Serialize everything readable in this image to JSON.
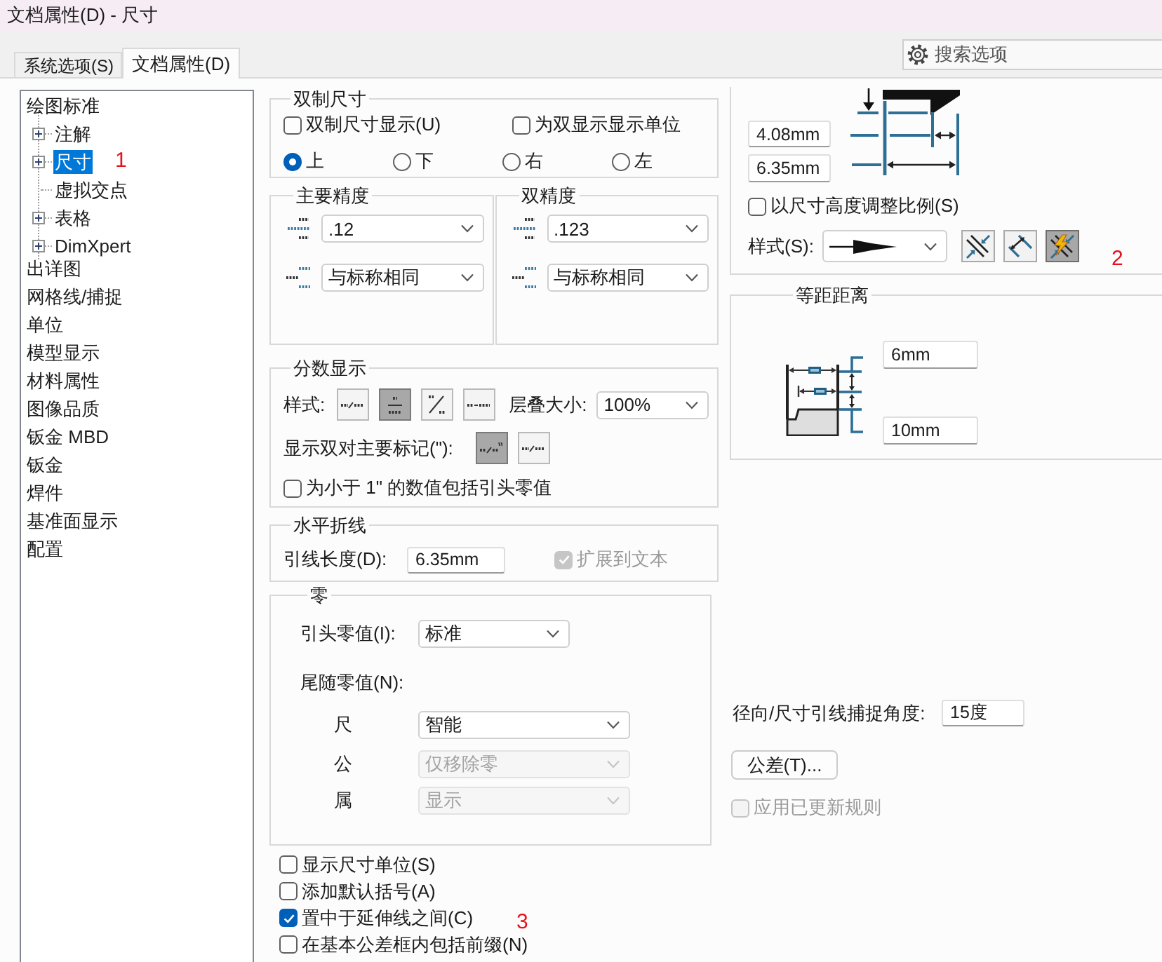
{
  "window": {
    "title": "文档属性(D) - 尺寸"
  },
  "tabs": [
    {
      "label": "系统选项(S)",
      "selected": false
    },
    {
      "label": "文档属性(D)",
      "selected": true
    }
  ],
  "search": {
    "placeholder": "搜索选项"
  },
  "tree": [
    {
      "label": "绘图标准",
      "selected": false,
      "children": [
        {
          "label": "注解",
          "selected": false,
          "expanded": false
        },
        {
          "label": "尺寸",
          "selected": true,
          "expanded": false,
          "annotation": "1"
        },
        {
          "label": "虚拟交点",
          "selected": false
        },
        {
          "label": "表格",
          "selected": false,
          "expanded": false
        },
        {
          "label": "DimXpert",
          "selected": false,
          "expanded": false
        }
      ]
    },
    {
      "label": "出详图",
      "selected": false
    },
    {
      "label": "网格线/捕捉",
      "selected": false
    },
    {
      "label": "单位",
      "selected": false
    },
    {
      "label": "模型显示",
      "selected": false
    },
    {
      "label": "材料属性",
      "selected": false
    },
    {
      "label": "图像品质",
      "selected": false
    },
    {
      "label": "钣金 MBD",
      "selected": false
    },
    {
      "label": "钣金",
      "selected": false
    },
    {
      "label": "焊件",
      "selected": false
    },
    {
      "label": "基准面显示",
      "selected": false
    },
    {
      "label": "配置",
      "selected": false
    }
  ],
  "dual_dimensions": {
    "title": "双制尺寸",
    "checkboxes": [
      {
        "label": "双制尺寸显示(U)",
        "checked": false
      },
      {
        "label": "为双显示显示单位",
        "checked": false
      }
    ],
    "positions": [
      {
        "label": "上",
        "selected": true
      },
      {
        "label": "下",
        "selected": false
      },
      {
        "label": "右",
        "selected": false
      },
      {
        "label": "左",
        "selected": false
      }
    ]
  },
  "precision": [
    {
      "title": "主要精度",
      "value": ".12",
      "tolerance": "与标称相同"
    },
    {
      "title": "双精度",
      "value": ".123",
      "tolerance": "与标称相同"
    }
  ],
  "fraction_display": {
    "title": "分数显示",
    "style_label": "样式:",
    "styles": [
      {
        "kind": "inline",
        "selected": false
      },
      {
        "kind": "stacked",
        "selected": true
      },
      {
        "kind": "diagonal",
        "selected": false
      },
      {
        "kind": "dash",
        "selected": false
      }
    ],
    "stack_label": "层叠大小:",
    "stack_size": "100%",
    "dual_mark_label": "显示双对主要标记(\"):",
    "dual_marks": [
      {
        "kind": "inch",
        "selected": true
      },
      {
        "kind": "inline",
        "selected": false
      }
    ],
    "leading_zero": {
      "label": "为小于 1\" 的数值包括引头零值",
      "checked": false
    }
  },
  "horizontal_break": {
    "title": "水平折线",
    "length_label": "引线长度(D):",
    "length": "6.35mm",
    "extend": {
      "label": "扩展到文本",
      "checked": true,
      "disabled": true
    }
  },
  "zeros": {
    "title": "零",
    "leading_label": "引头零值(I):",
    "leading": {
      "value": "标准",
      "disabled": false
    },
    "trailing_label": "尾随零值(N):",
    "trailing": [
      {
        "label": "尺",
        "value": "智能",
        "disabled": false
      },
      {
        "label": "公",
        "value": "仅移除零",
        "disabled": true
      },
      {
        "label": "属",
        "value": "显示",
        "disabled": true
      }
    ]
  },
  "options": [
    {
      "label": "显示尺寸单位(S)",
      "checked": false
    },
    {
      "label": "添加默认括号(A)",
      "checked": false
    },
    {
      "label": "置中于延伸线之间(C)",
      "checked": true,
      "annotation": "3"
    },
    {
      "label": "在基本公差框内包括前缀(N)",
      "checked": false
    }
  ],
  "arrows": {
    "gap": "4.08mm",
    "length": "6.35mm",
    "scale": {
      "label": "以尺寸高度调整比例(S)",
      "checked": false
    },
    "style_label": "样式(S):",
    "placements": [
      {
        "kind": "inside",
        "selected": false
      },
      {
        "kind": "outside",
        "selected": false
      },
      {
        "kind": "smart",
        "selected": true
      }
    ],
    "annotation": "2"
  },
  "offset_distances": {
    "title": "等距距离",
    "first": "6mm",
    "second": "10mm"
  },
  "snap_angle": {
    "label": "径向/尺寸引线捕捉角度:",
    "value": "15度"
  },
  "tolerance_button": {
    "label": "公差(T)..."
  },
  "apply_rules": {
    "label": "应用已更新规则",
    "checked": false,
    "disabled": true
  }
}
